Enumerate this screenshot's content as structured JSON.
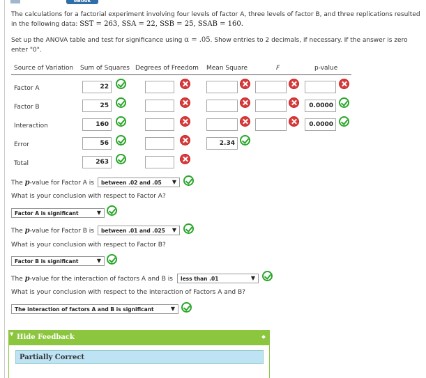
{
  "header": {
    "ebook_label": "eBook"
  },
  "problem": {
    "line1_text": "The calculations for a factorial experiment involving four levels of factor A, three levels of factor B, and three replications resulted",
    "line2_prefix": "in the following data: ",
    "line2_math": "SST = 263, SSA = 22, SSB = 25, SSAB = 160."
  },
  "instructions": {
    "line1_prefix": "Set up the ANOVA table and test for significance using ",
    "line1_math": "α = .05",
    "line1_suffix": ". Show entries to 2 decimals, if necessary. If the answer is zero",
    "line2": "enter \"0\"."
  },
  "table": {
    "headers": [
      "Source of Variation",
      "Sum of Squares",
      "Degrees of Freedom",
      "Mean Square",
      "F",
      "p-value"
    ],
    "rows": [
      {
        "label": "Factor A",
        "ss": "22",
        "df": "",
        "ms": "",
        "f": "",
        "p": ""
      },
      {
        "label": "Factor B",
        "ss": "25",
        "df": "",
        "ms": "",
        "f": "",
        "p": "0.0000"
      },
      {
        "label": "Interaction",
        "ss": "160",
        "df": "",
        "ms": "",
        "f": "",
        "p": "0.0000"
      },
      {
        "label": "Error",
        "ss": "56",
        "df": "",
        "ms": "2.34"
      },
      {
        "label": "Total",
        "ss": "263",
        "df": ""
      }
    ]
  },
  "questions": {
    "q1_prefix": "The ",
    "q1_var": "p",
    "q1_suffix": "-value for Factor A is",
    "q1_selected": "between .02 and .05",
    "q2": "What is your conclusion with respect to Factor A?",
    "q2_selected": "Factor A is significant",
    "q3_prefix": "The ",
    "q3_var": "p",
    "q3_suffix": "-value for Factor B is",
    "q3_selected": "between .01 and .025",
    "q4": "What is your conclusion with respect to Factor B?",
    "q4_selected": "Factor B is significant",
    "q5_prefix": "The ",
    "q5_var": "p",
    "q5_suffix": "-value for the interaction of factors A and B is",
    "q5_selected": "less than .01",
    "q6": "What is your conclusion with respect to the interaction of Factors A and B?",
    "q6_selected": "The interaction of factors A and B is significant"
  },
  "feedback": {
    "toggle_label": "Hide Feedback",
    "result": "Partially Correct"
  },
  "icons": {
    "correct": "check-circle-icon",
    "incorrect": "x-circle-icon",
    "dropdown": "chevron-down-icon"
  },
  "colors": {
    "correct": "#29a629",
    "incorrect": "#d63b3b",
    "feedback_header": "#8cc63f",
    "feedback_box": "#bde3f5"
  }
}
